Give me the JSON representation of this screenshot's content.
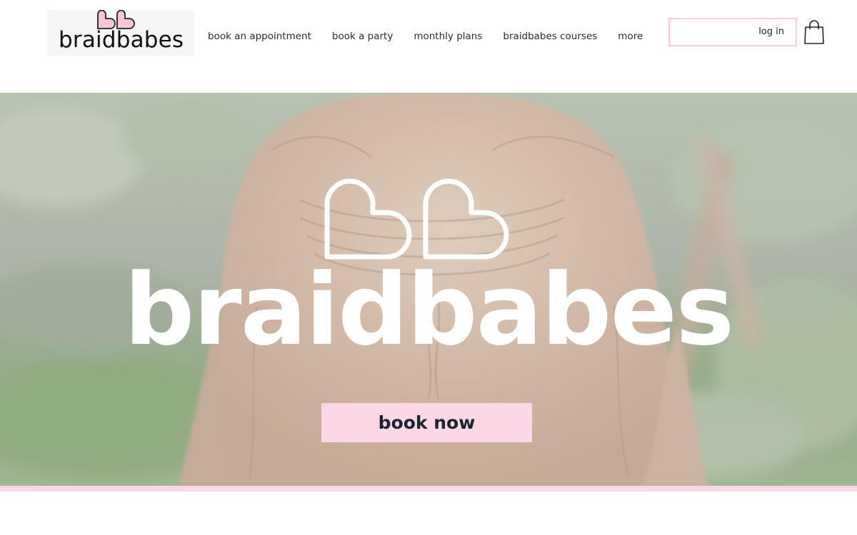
{
  "header": {
    "logo_text": "braidbabes",
    "nav": [
      {
        "label": "book an appointment"
      },
      {
        "label": "book a party"
      },
      {
        "label": "monthly plans"
      },
      {
        "label": "braidbabes courses"
      },
      {
        "label": "more"
      }
    ],
    "login_label": "log in",
    "cart_icon": "shopping-bag-icon"
  },
  "hero": {
    "title": "braidbabes",
    "button_label": "book now",
    "icon": "double-heart-icon"
  },
  "colors": {
    "accent_pink": "#fdd7e5",
    "login_border": "#f7cfe0",
    "text_dark": "#1c2430"
  }
}
